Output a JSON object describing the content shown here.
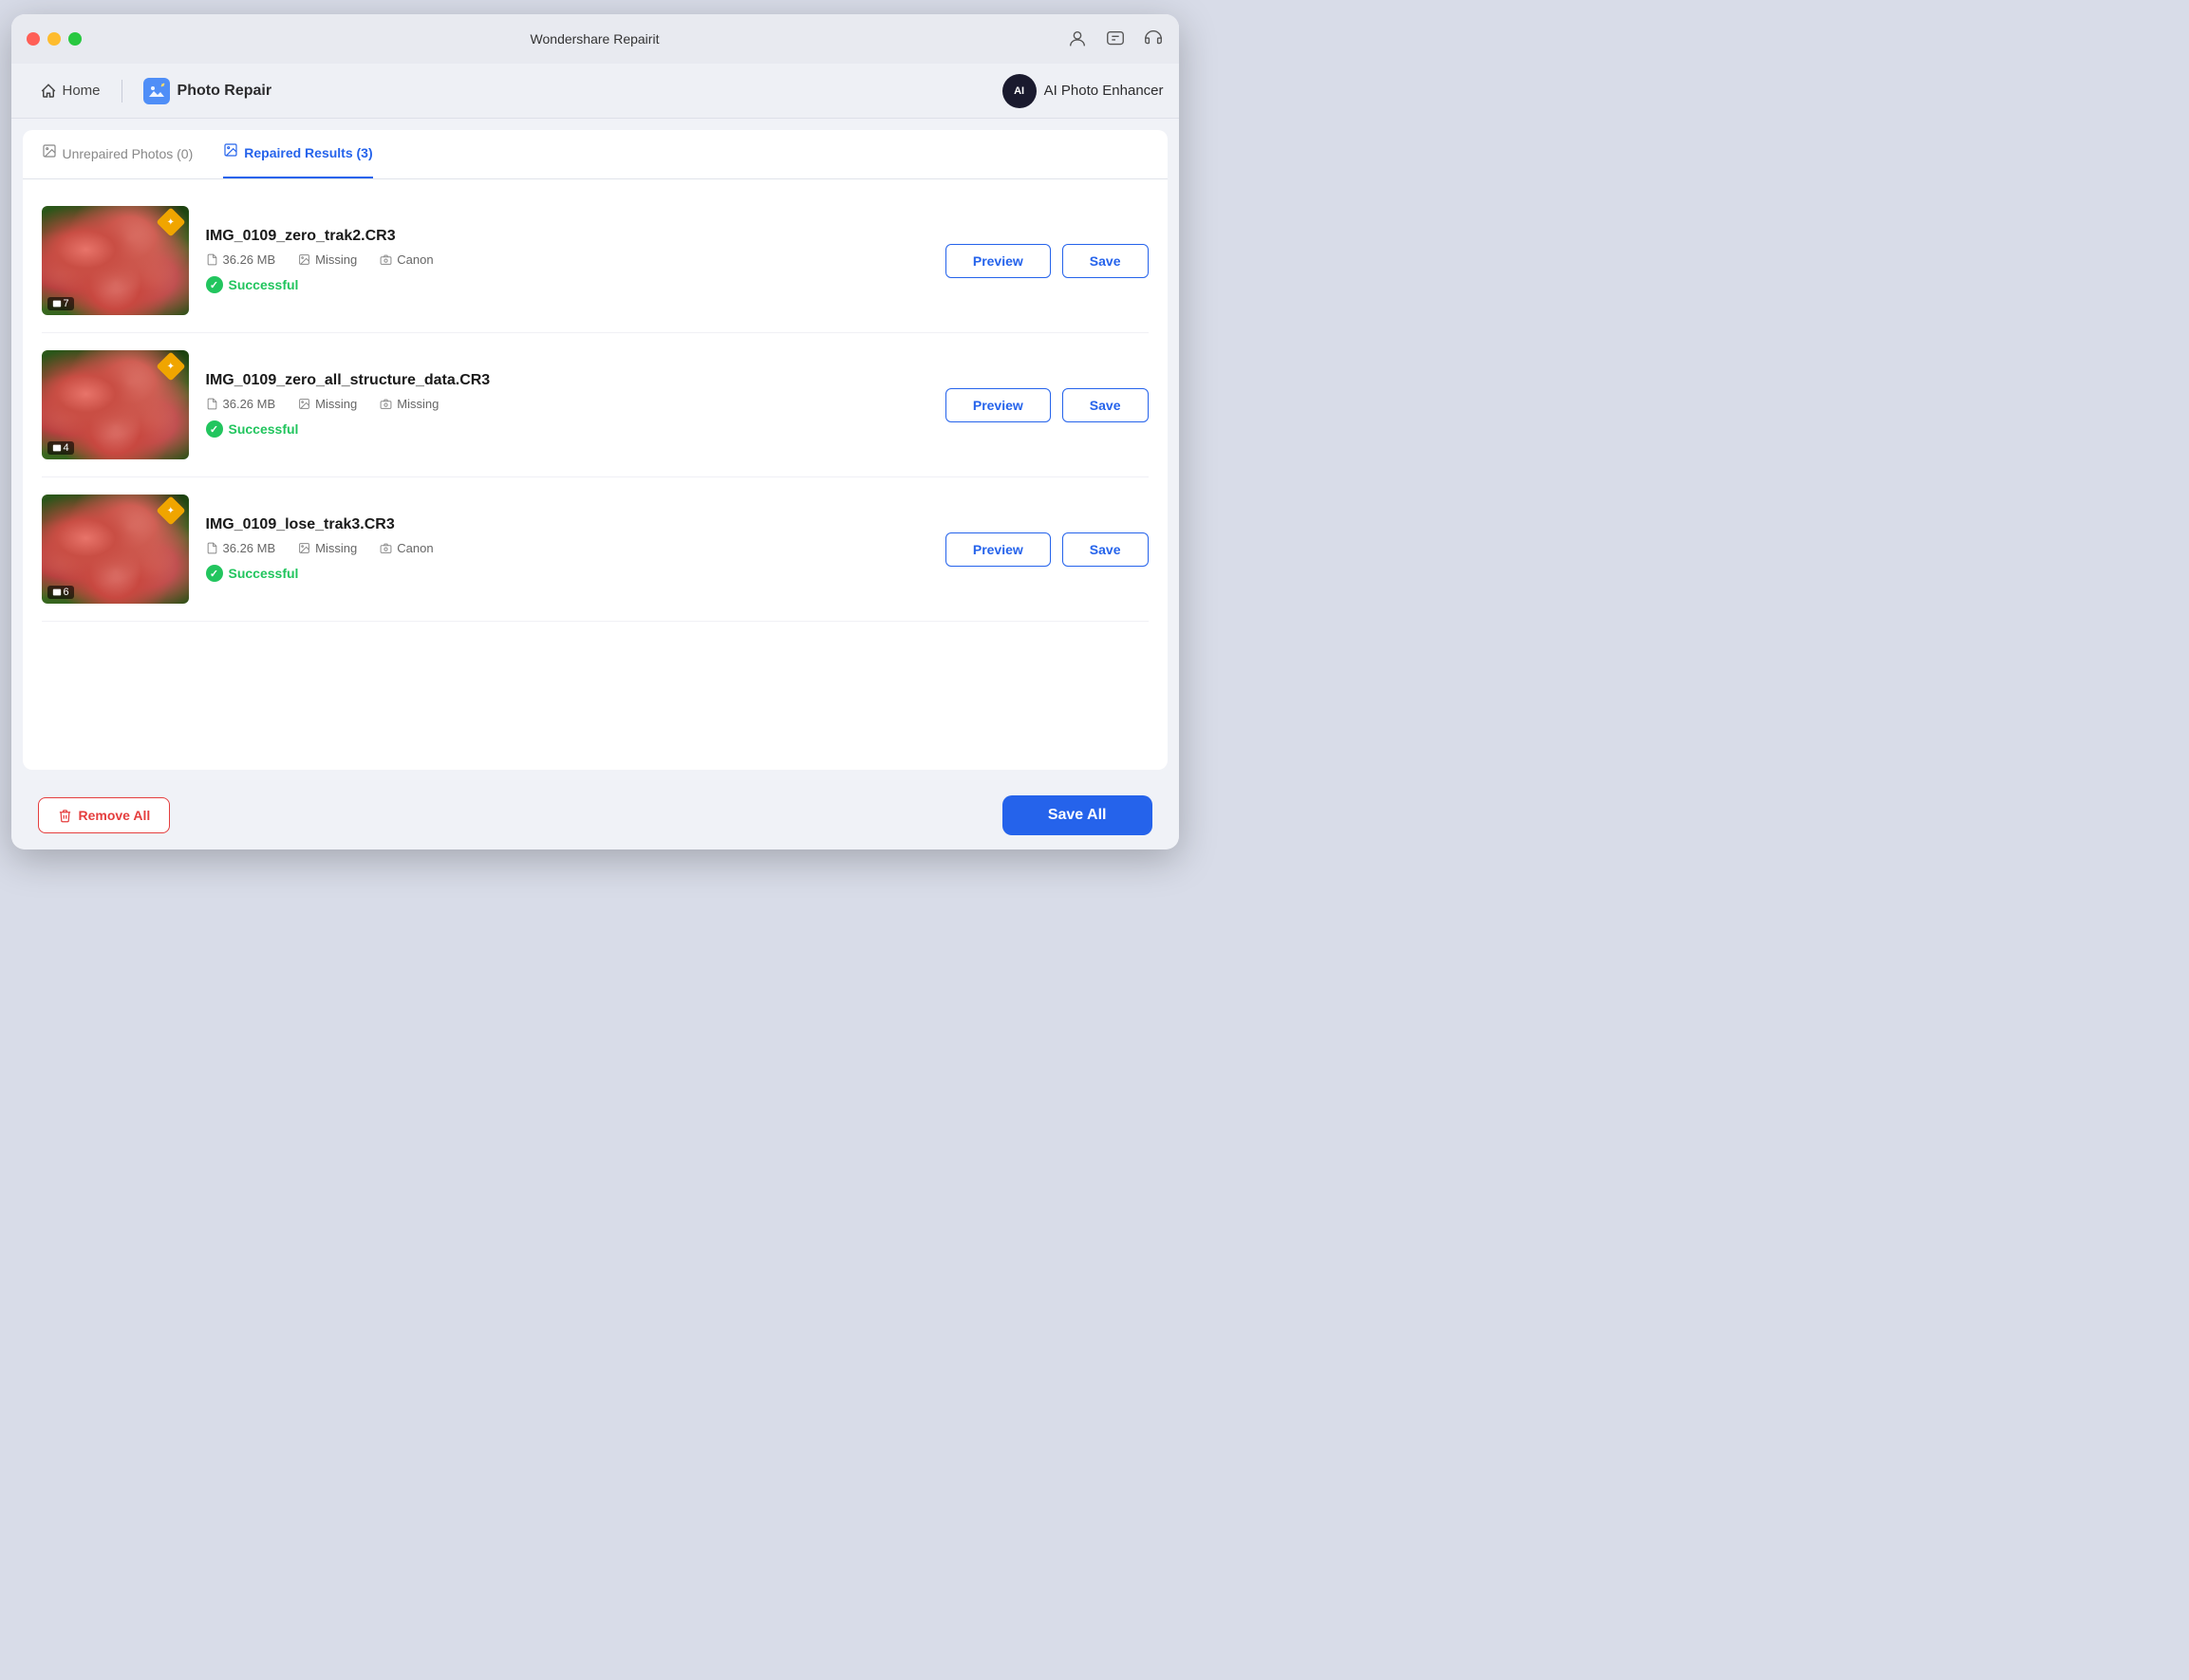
{
  "app": {
    "title": "Wondershare Repairit",
    "window_buttons": {
      "close": "close",
      "minimize": "minimize",
      "maximize": "maximize"
    }
  },
  "navbar": {
    "home_label": "Home",
    "photo_repair_label": "Photo Repair",
    "ai_enhancer_label": "AI Photo Enhancer",
    "ai_badge": "AI"
  },
  "tabs": {
    "unrepaired": "Unrepaired Photos (0)",
    "repaired": "Repaired Results (3)"
  },
  "items": [
    {
      "filename": "IMG_0109_zero_trak2.CR3",
      "size": "36.26 MB",
      "issue1": "Missing",
      "issue2": "Canon",
      "status": "Successful",
      "count": "7",
      "preview_label": "Preview",
      "save_label": "Save"
    },
    {
      "filename": "IMG_0109_zero_all_structure_data.CR3",
      "size": "36.26 MB",
      "issue1": "Missing",
      "issue2": "Missing",
      "status": "Successful",
      "count": "4",
      "preview_label": "Preview",
      "save_label": "Save"
    },
    {
      "filename": "IMG_0109_lose_trak3.CR3",
      "size": "36.26 MB",
      "issue1": "Missing",
      "issue2": "Canon",
      "status": "Successful",
      "count": "6",
      "preview_label": "Preview",
      "save_label": "Save"
    }
  ],
  "bottom_bar": {
    "remove_all_label": "Remove All",
    "save_all_label": "Save All"
  }
}
